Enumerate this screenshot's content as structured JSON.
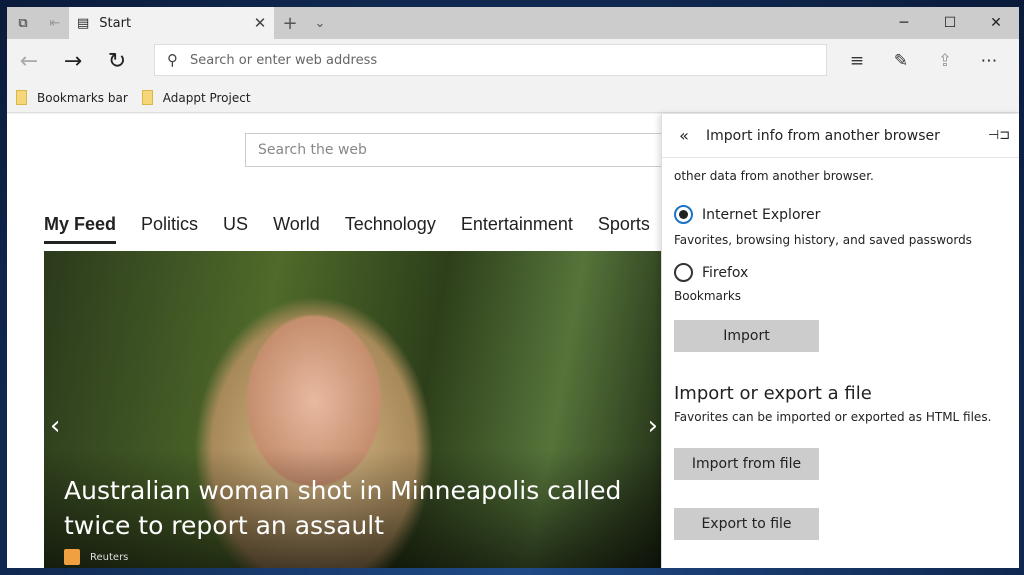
{
  "tab": {
    "title": "Start"
  },
  "address": {
    "placeholder": "Search or enter web address"
  },
  "bookmarks": [
    "Bookmarks bar",
    "Adappt Project"
  ],
  "page": {
    "search_placeholder": "Search the web",
    "categories": [
      "My Feed",
      "Politics",
      "US",
      "World",
      "Technology",
      "Entertainment",
      "Sports"
    ],
    "headline": "Australian woman shot in Minneapolis called twice to report an assault",
    "source": "Reuters"
  },
  "panel": {
    "title": "Import info from another browser",
    "intro": "other data from another browser.",
    "options": [
      {
        "label": "Internet Explorer",
        "desc": "Favorites, browsing history, and saved passwords",
        "selected": true
      },
      {
        "label": "Firefox",
        "desc": "Bookmarks",
        "selected": false
      }
    ],
    "import_label": "Import",
    "file_heading": "Import or export a file",
    "file_desc": "Favorites can be imported or exported as HTML files.",
    "import_file_label": "Import from file",
    "export_file_label": "Export to file"
  }
}
